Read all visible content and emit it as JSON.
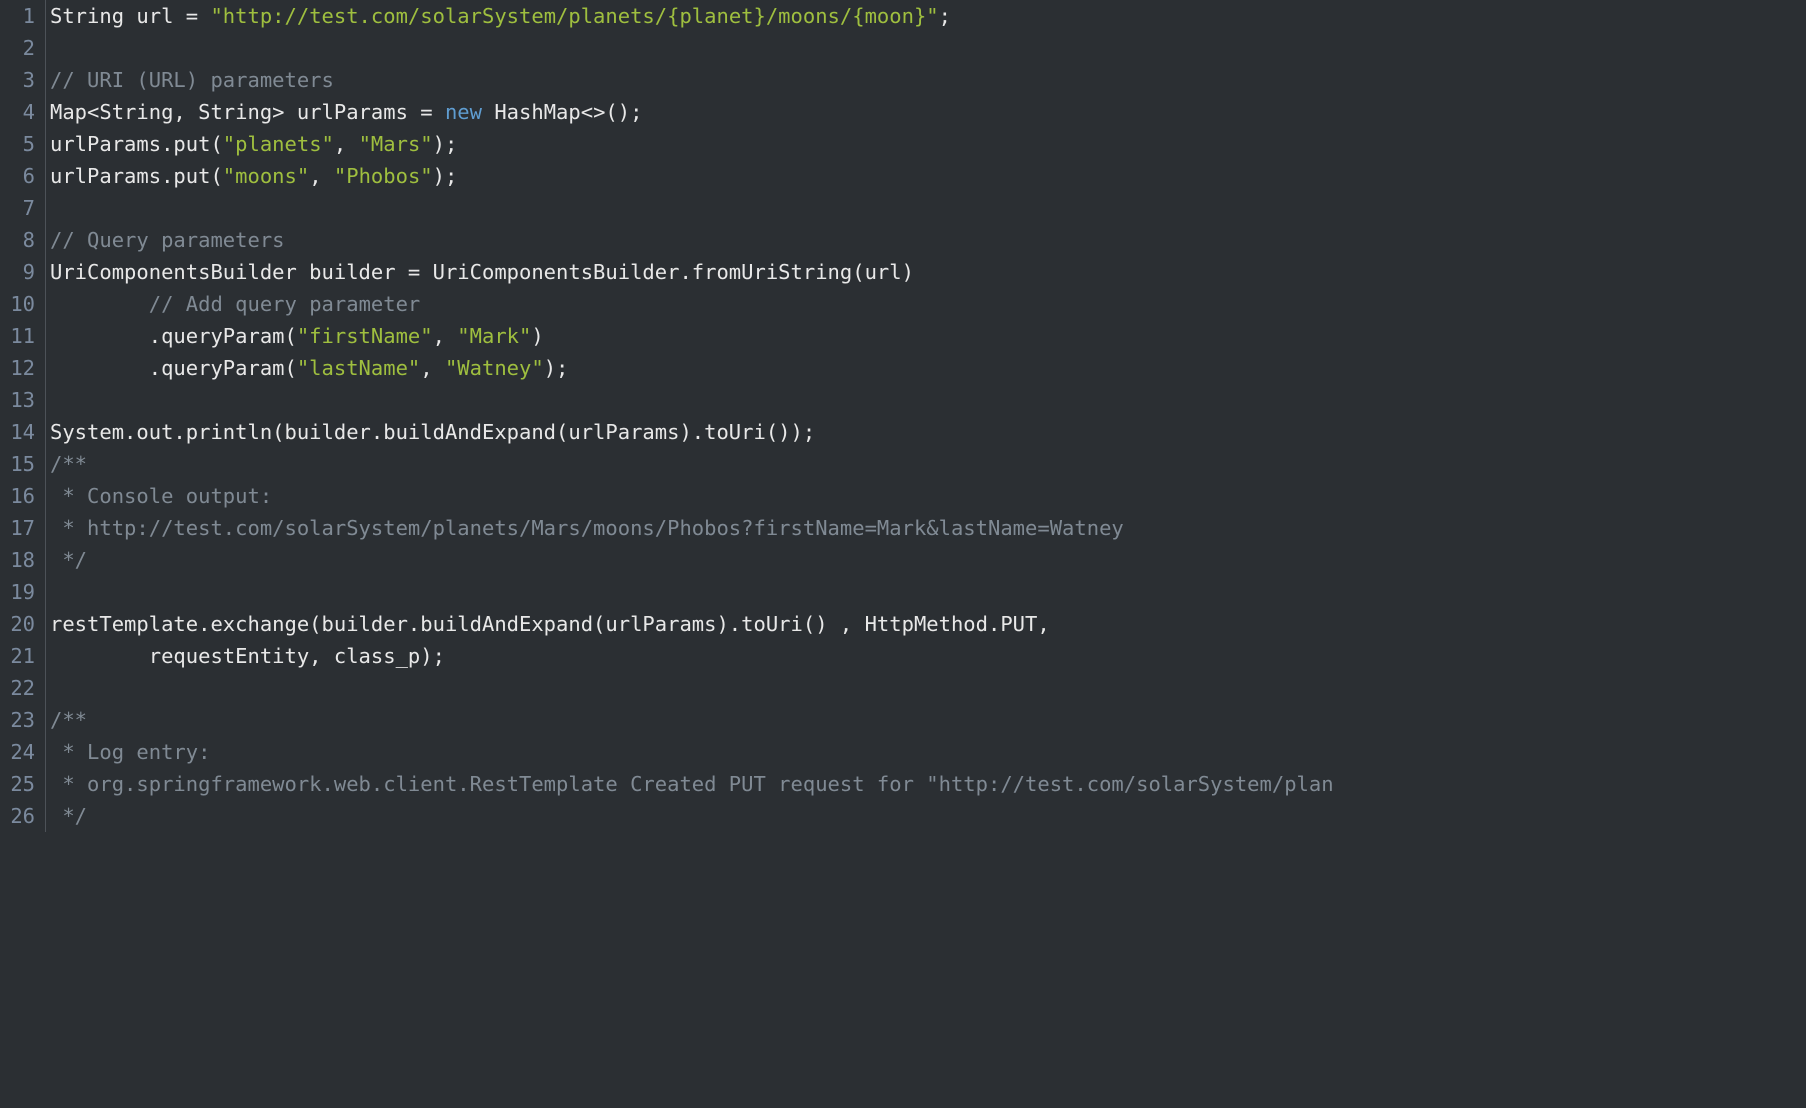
{
  "lines": [
    {
      "num": "1",
      "tokens": [
        {
          "cls": "tok-def",
          "t": "String url = "
        },
        {
          "cls": "tok-str",
          "t": "\"http://test.com/solarSystem/planets/{planet}/moons/{moon}\""
        },
        {
          "cls": "tok-def",
          "t": ";"
        }
      ]
    },
    {
      "num": "2",
      "tokens": []
    },
    {
      "num": "3",
      "tokens": [
        {
          "cls": "tok-cmt",
          "t": "// URI (URL) parameters"
        }
      ]
    },
    {
      "num": "4",
      "tokens": [
        {
          "cls": "tok-def",
          "t": "Map<String, String> urlParams = "
        },
        {
          "cls": "tok-kw",
          "t": "new"
        },
        {
          "cls": "tok-def",
          "t": " HashMap<>();"
        }
      ]
    },
    {
      "num": "5",
      "tokens": [
        {
          "cls": "tok-def",
          "t": "urlParams.put("
        },
        {
          "cls": "tok-str",
          "t": "\"planets\""
        },
        {
          "cls": "tok-def",
          "t": ", "
        },
        {
          "cls": "tok-str",
          "t": "\"Mars\""
        },
        {
          "cls": "tok-def",
          "t": ");"
        }
      ]
    },
    {
      "num": "6",
      "tokens": [
        {
          "cls": "tok-def",
          "t": "urlParams.put("
        },
        {
          "cls": "tok-str",
          "t": "\"moons\""
        },
        {
          "cls": "tok-def",
          "t": ", "
        },
        {
          "cls": "tok-str",
          "t": "\"Phobos\""
        },
        {
          "cls": "tok-def",
          "t": ");"
        }
      ]
    },
    {
      "num": "7",
      "tokens": []
    },
    {
      "num": "8",
      "tokens": [
        {
          "cls": "tok-cmt",
          "t": "// Query parameters"
        }
      ]
    },
    {
      "num": "9",
      "tokens": [
        {
          "cls": "tok-def",
          "t": "UriComponentsBuilder builder = UriComponentsBuilder.fromUriString(url)"
        }
      ]
    },
    {
      "num": "10",
      "tokens": [
        {
          "cls": "tok-def",
          "t": "        "
        },
        {
          "cls": "tok-cmt",
          "t": "// Add query parameter"
        }
      ]
    },
    {
      "num": "11",
      "tokens": [
        {
          "cls": "tok-def",
          "t": "        .queryParam("
        },
        {
          "cls": "tok-str",
          "t": "\"firstName\""
        },
        {
          "cls": "tok-def",
          "t": ", "
        },
        {
          "cls": "tok-str",
          "t": "\"Mark\""
        },
        {
          "cls": "tok-def",
          "t": ")"
        }
      ]
    },
    {
      "num": "12",
      "tokens": [
        {
          "cls": "tok-def",
          "t": "        .queryParam("
        },
        {
          "cls": "tok-str",
          "t": "\"lastName\""
        },
        {
          "cls": "tok-def",
          "t": ", "
        },
        {
          "cls": "tok-str",
          "t": "\"Watney\""
        },
        {
          "cls": "tok-def",
          "t": ");"
        }
      ]
    },
    {
      "num": "13",
      "tokens": []
    },
    {
      "num": "14",
      "tokens": [
        {
          "cls": "tok-def",
          "t": "System.out.println(builder.buildAndExpand(urlParams).toUri());"
        }
      ]
    },
    {
      "num": "15",
      "tokens": [
        {
          "cls": "tok-cmt",
          "t": "/**"
        }
      ]
    },
    {
      "num": "16",
      "tokens": [
        {
          "cls": "tok-cmt",
          "t": " * Console output:"
        }
      ]
    },
    {
      "num": "17",
      "tokens": [
        {
          "cls": "tok-cmt",
          "t": " * http://test.com/solarSystem/planets/Mars/moons/Phobos?firstName=Mark&lastName=Watney"
        }
      ]
    },
    {
      "num": "18",
      "tokens": [
        {
          "cls": "tok-cmt",
          "t": " */"
        }
      ]
    },
    {
      "num": "19",
      "tokens": []
    },
    {
      "num": "20",
      "tokens": [
        {
          "cls": "tok-def",
          "t": "restTemplate.exchange(builder.buildAndExpand(urlParams).toUri() , HttpMethod.PUT,"
        }
      ]
    },
    {
      "num": "21",
      "tokens": [
        {
          "cls": "tok-def",
          "t": "        requestEntity, class_p);"
        }
      ]
    },
    {
      "num": "22",
      "tokens": []
    },
    {
      "num": "23",
      "tokens": [
        {
          "cls": "tok-cmt",
          "t": "/**"
        }
      ]
    },
    {
      "num": "24",
      "tokens": [
        {
          "cls": "tok-cmt",
          "t": " * Log entry:"
        }
      ]
    },
    {
      "num": "25",
      "tokens": [
        {
          "cls": "tok-cmt",
          "t": " * org.springframework.web.client.RestTemplate Created PUT request for \"http://test.com/solarSystem/plan"
        }
      ]
    },
    {
      "num": "26",
      "tokens": [
        {
          "cls": "tok-cmt",
          "t": " */"
        }
      ]
    }
  ]
}
